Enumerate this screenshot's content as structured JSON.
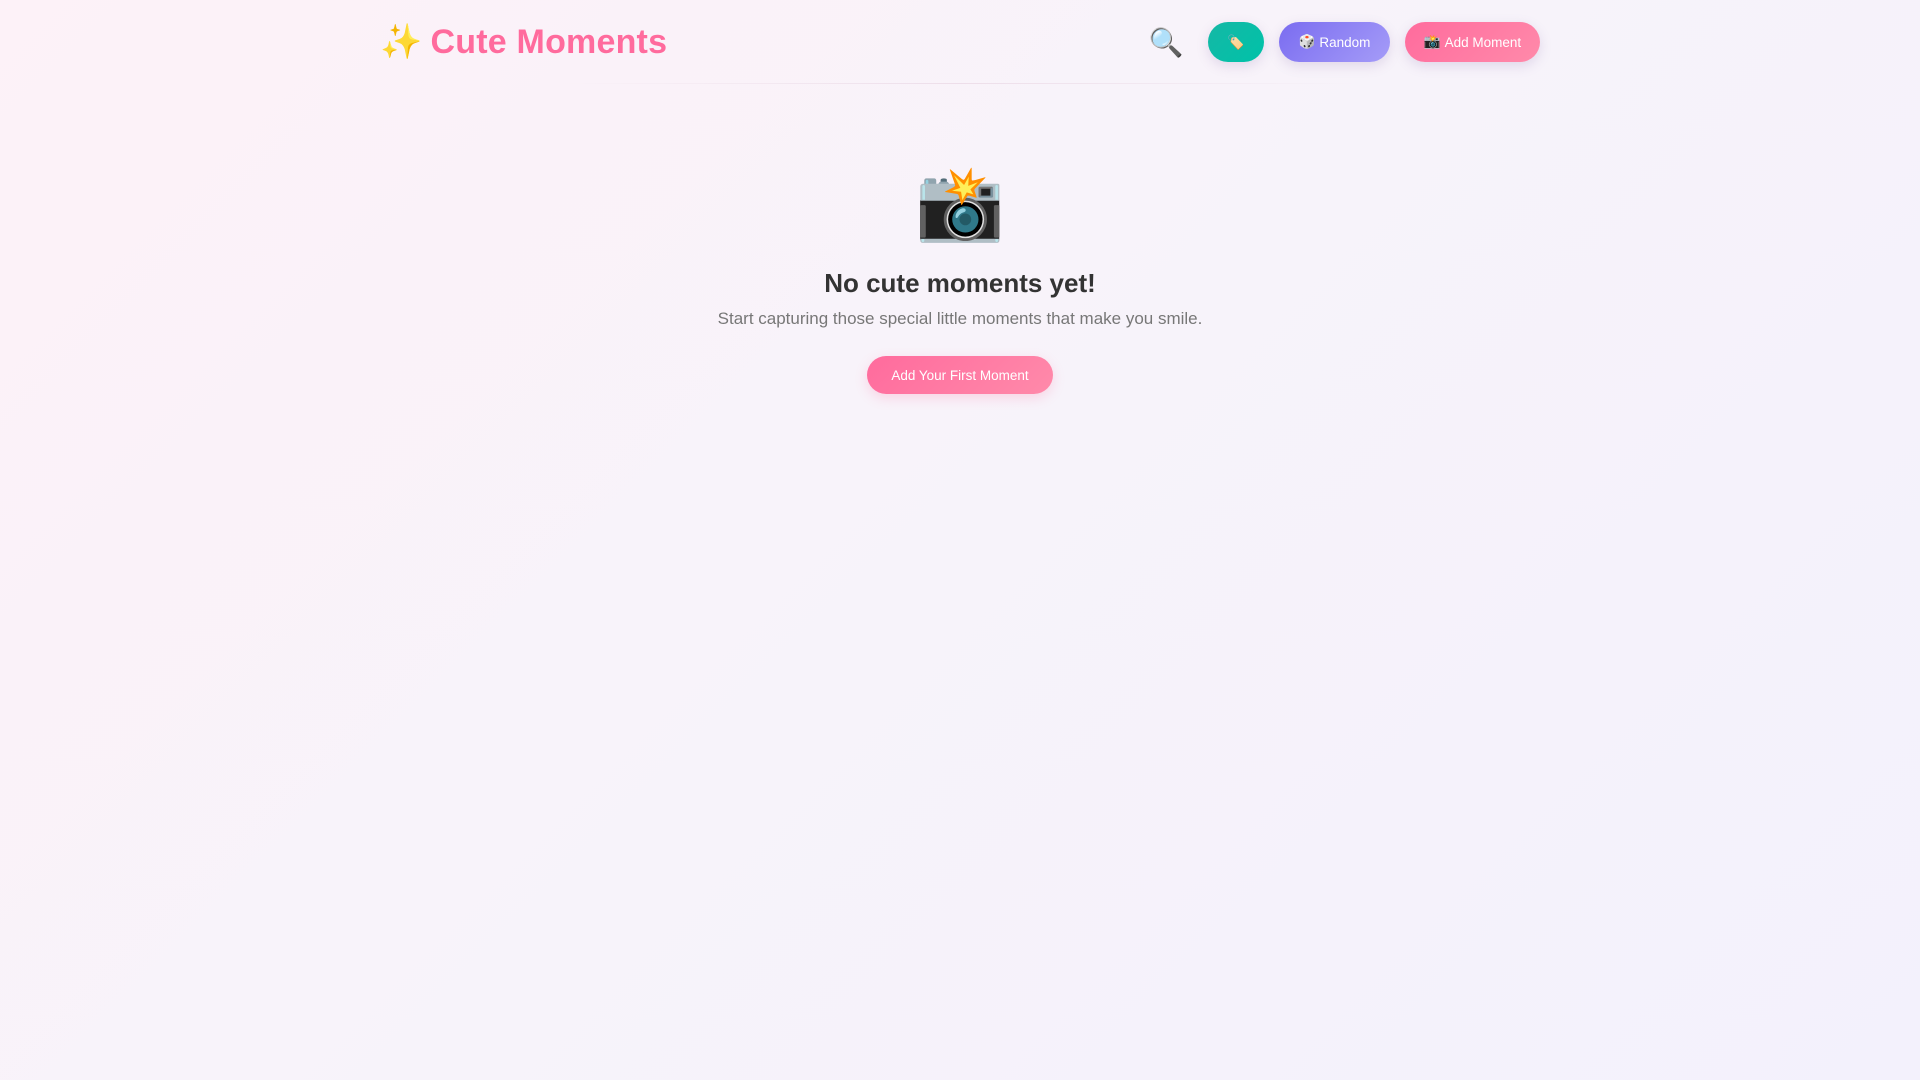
{
  "header": {
    "logo_icon": "✨",
    "title": "Cute Moments",
    "search_icon": "🔍",
    "tags_button": {
      "icon": "🏷️",
      "label": ""
    },
    "random_button": {
      "icon": "🎲",
      "label": "Random"
    },
    "add_button": {
      "icon": "📸",
      "label": "Add Moment"
    }
  },
  "empty_state": {
    "icon": "📸",
    "title": "No cute moments yet!",
    "subtitle": "Start capturing those special little moments that make you smile.",
    "cta_label": "Add Your First Moment"
  },
  "colors": {
    "brand_pink": "#ff6b9d",
    "teal": "#15b8a6",
    "purple": "#7a6cf0",
    "text_dark": "#333333",
    "text_muted": "#777777"
  },
  "icons": [
    "sparkles-icon",
    "search-icon",
    "tag-icon",
    "dice-icon",
    "camera-flash-icon"
  ]
}
